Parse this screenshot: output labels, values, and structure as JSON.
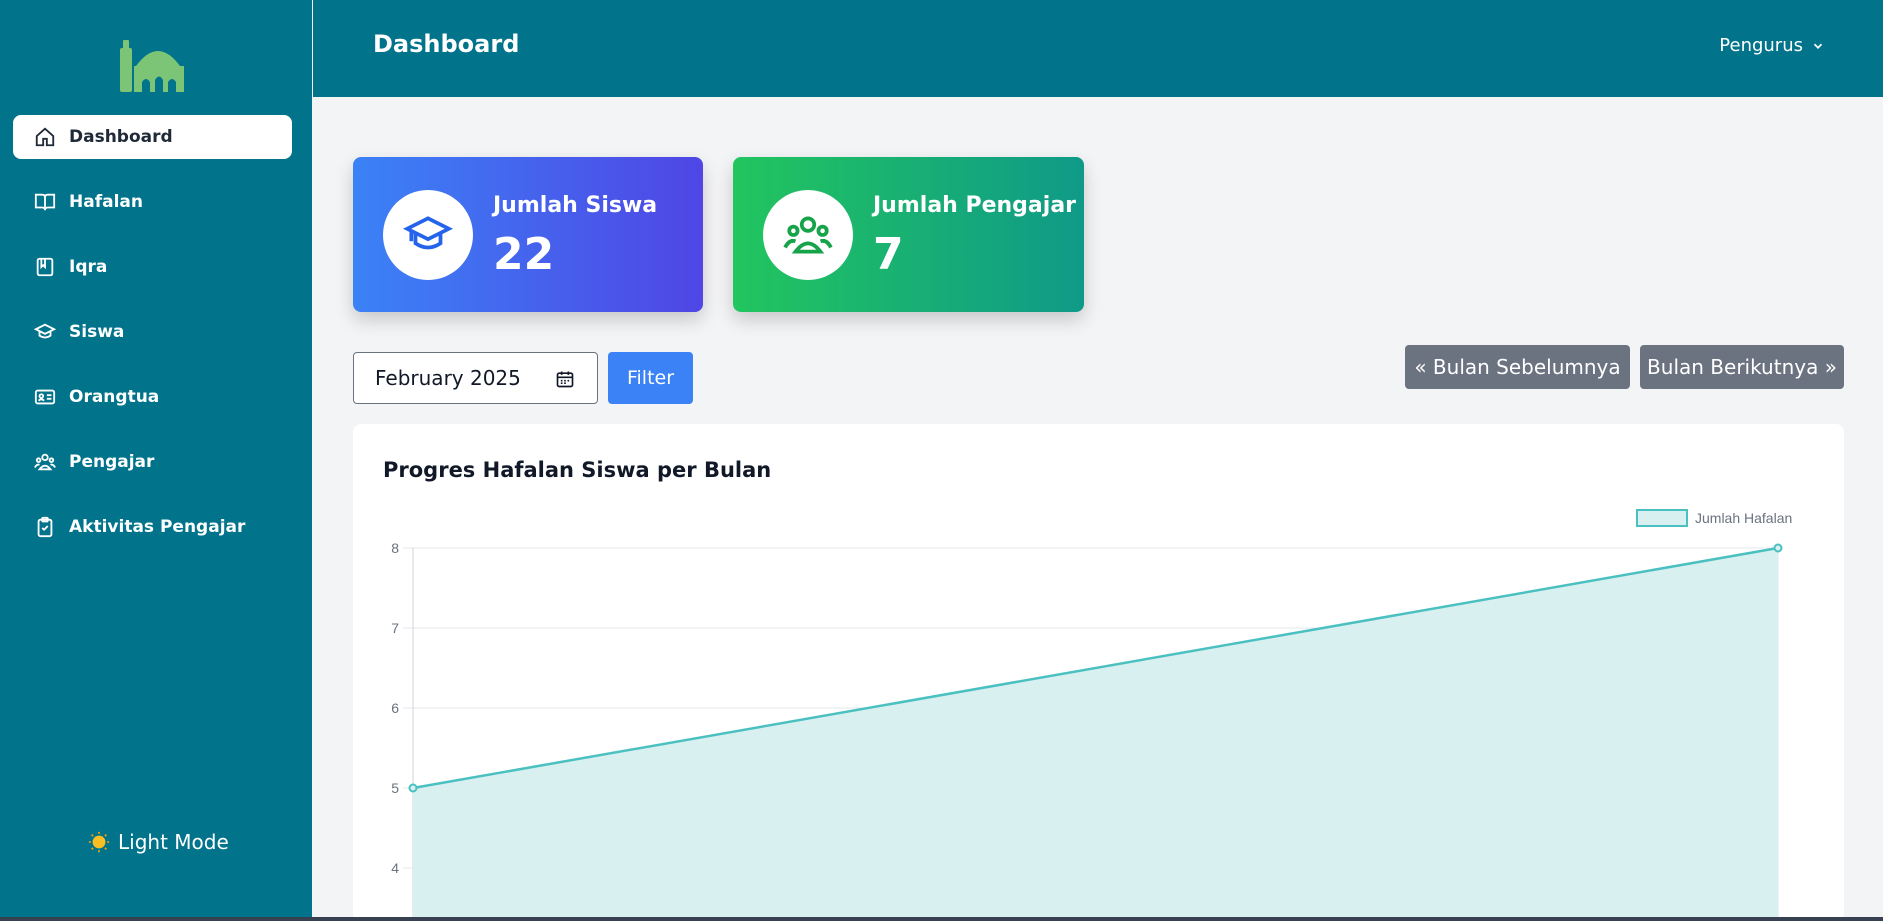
{
  "sidebar": {
    "logo_icon": "mosque-icon",
    "items": [
      {
        "label": "Dashboard",
        "icon": "home-icon",
        "active": true
      },
      {
        "label": "Hafalan",
        "icon": "book-open-icon"
      },
      {
        "label": "Iqra",
        "icon": "book-icon"
      },
      {
        "label": "Siswa",
        "icon": "graduation-cap-icon"
      },
      {
        "label": "Orangtua",
        "icon": "id-card-icon"
      },
      {
        "label": "Pengajar",
        "icon": "users-icon"
      },
      {
        "label": "Aktivitas Pengajar",
        "icon": "clipboard-check-icon"
      }
    ],
    "light_mode_label": "Light Mode"
  },
  "header": {
    "title": "Dashboard",
    "user_menu": "Pengurus"
  },
  "stats": [
    {
      "label": "Jumlah Siswa",
      "value": "22",
      "icon": "graduation-cap-icon"
    },
    {
      "label": "Jumlah Pengajar",
      "value": "7",
      "icon": "users-icon"
    }
  ],
  "filter": {
    "month_value": "February 2025",
    "filter_label": "Filter",
    "prev_label": "« Bulan Sebelumnya",
    "next_label": "Bulan Berikutnya »"
  },
  "chart": {
    "title": "Progres Hafalan Siswa per Bulan"
  },
  "colors": {
    "sidebar": "#01738b",
    "line": "#4bc0c0",
    "fill": "#d9f0f1"
  },
  "chart_data": {
    "type": "area",
    "title": "Progres Hafalan Siswa per Bulan",
    "series": [
      {
        "name": "Jumlah Hafalan",
        "x": [
          0,
          1
        ],
        "values": [
          5,
          8
        ]
      }
    ],
    "y_ticks": [
      "8",
      "7",
      "6",
      "5",
      "4"
    ],
    "ylim": [
      4,
      8
    ],
    "grid": true,
    "legend": "top-right"
  }
}
